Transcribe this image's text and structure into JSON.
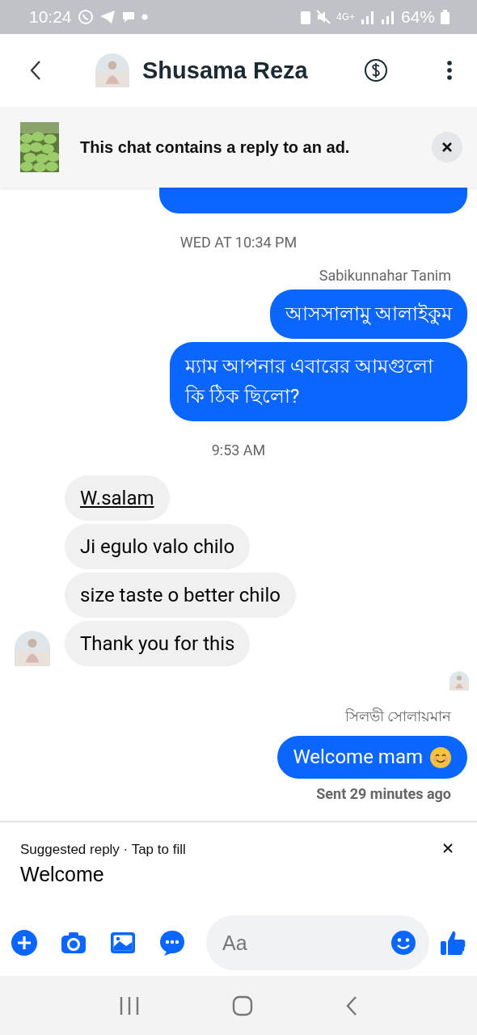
{
  "status_bar": {
    "time": "10:24",
    "network": "4G+",
    "battery": "64%"
  },
  "header": {
    "title": "Shusama Reza"
  },
  "ad_banner": {
    "text": "This chat contains a reply to an ad."
  },
  "messages": [
    {
      "kind": "cut-bubble"
    },
    {
      "kind": "timestamp",
      "text": "WED AT 10:34 PM"
    },
    {
      "kind": "sender",
      "text": "Sabikunnahar Tanim"
    },
    {
      "kind": "outgoing",
      "text": "আসসালামু আলাইকুম",
      "emoji": false
    },
    {
      "kind": "outgoing",
      "text": "ম্যাম আপনার এবারের আমগুলো কি ঠিক ছিলো?",
      "emoji": false
    },
    {
      "kind": "timestamp",
      "text": "9:53 AM"
    },
    {
      "kind": "incoming",
      "text": "W.salam",
      "link": true,
      "avatar": false
    },
    {
      "kind": "incoming",
      "text": "Ji egulo valo chilo",
      "link": false,
      "avatar": false
    },
    {
      "kind": "incoming",
      "text": "size taste o better chilo",
      "link": false,
      "avatar": false
    },
    {
      "kind": "incoming",
      "text": "Thank you for this",
      "link": false,
      "avatar": true
    },
    {
      "kind": "seen"
    },
    {
      "kind": "sender",
      "text": "সিলভী সোলায়মান"
    },
    {
      "kind": "outgoing",
      "text": "Welcome mam",
      "emoji": true
    },
    {
      "kind": "status",
      "text": "Sent 29 minutes ago"
    }
  ],
  "suggested_reply": {
    "label": "Suggested reply · Tap to fill",
    "text": "Welcome"
  },
  "composer": {
    "placeholder": "Aa"
  }
}
